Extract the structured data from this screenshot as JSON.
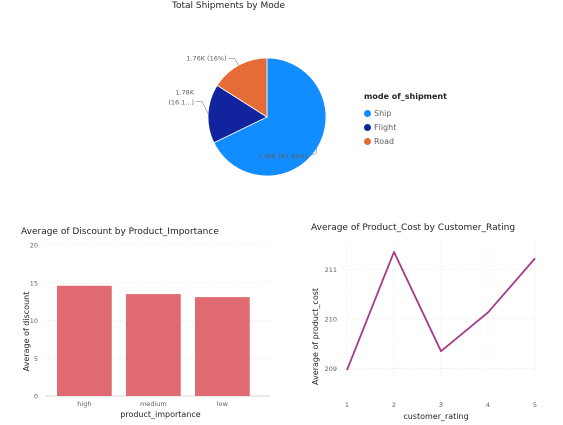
{
  "chart_data": [
    {
      "type": "pie",
      "title": "Total Shipments by Mode",
      "legend_title": "mode of_shipment",
      "legend_position": "right",
      "slices": [
        {
          "name": "Ship",
          "value": 7460,
          "label": "7.46K (67.84%)",
          "color": "#118DFF"
        },
        {
          "name": "Flight",
          "value": 1780,
          "label_lines": [
            "1.78K",
            "(16.1...)"
          ],
          "color": "#12239E"
        },
        {
          "name": "Road",
          "value": 1760,
          "label": "1.76K (16%)",
          "color": "#E66C37"
        }
      ]
    },
    {
      "type": "bar",
      "title": "Average of Discount by Product_Importance",
      "xlabel": "product_importance",
      "ylabel": "Average of discount",
      "categories": [
        "high",
        "medium",
        "low"
      ],
      "values": [
        14.6,
        13.5,
        13.1
      ],
      "ylim": [
        0,
        20
      ],
      "yticks": [
        "0",
        "5",
        "10",
        "15",
        "20"
      ],
      "color": "#E06A72",
      "grid": true
    },
    {
      "type": "line",
      "title": "Average of Product_Cost by Customer_Rating",
      "xlabel": "customer_rating",
      "ylabel": "Average of product_cost",
      "x": [
        1,
        2,
        3,
        4,
        5
      ],
      "xticks": [
        "1",
        "2",
        "3",
        "4",
        "5"
      ],
      "values": [
        208.97,
        211.35,
        209.35,
        210.13,
        211.22
      ],
      "ylim": [
        208.87,
        211.55
      ],
      "yticks": [
        "209",
        "210",
        "211"
      ],
      "color": "#A43B8B",
      "grid": true
    }
  ]
}
